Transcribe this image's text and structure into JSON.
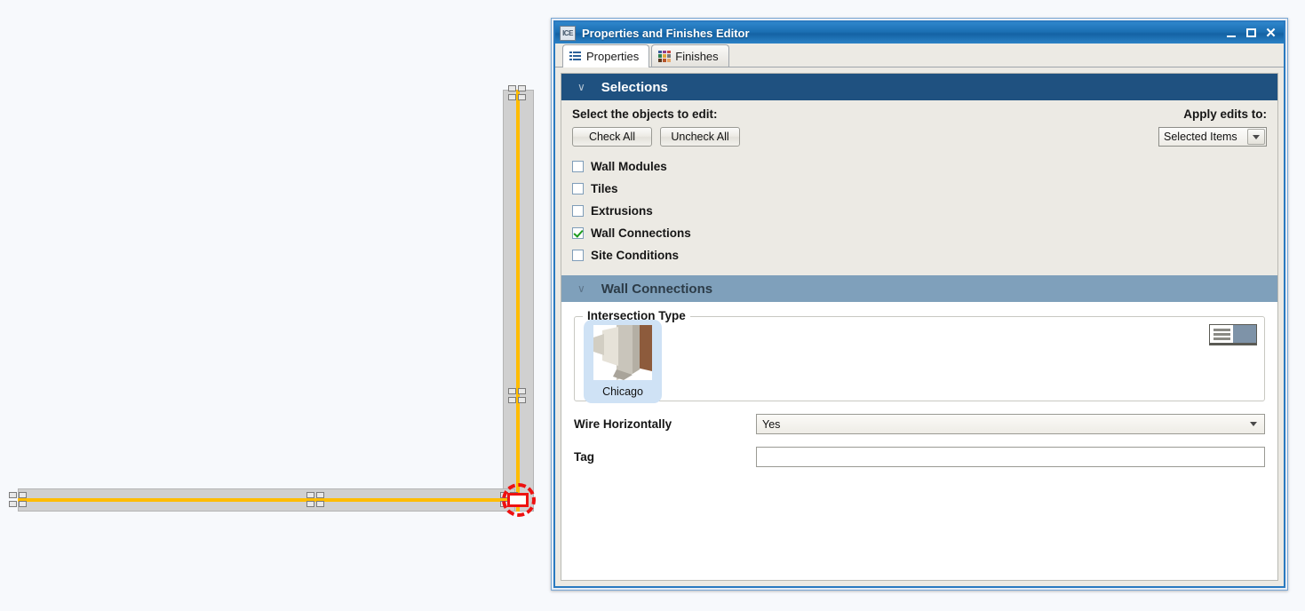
{
  "window": {
    "app_icon_label": "ICE",
    "title": "Properties and Finishes Editor",
    "minimize_label": "–",
    "maximize_label": "□",
    "close_label": "✕",
    "accent_color": "#1b6fb3"
  },
  "tabs": [
    {
      "label": "Properties",
      "icon": "list-properties-icon",
      "active": true
    },
    {
      "label": "Finishes",
      "icon": "color-swatches-icon",
      "active": false
    }
  ],
  "selections": {
    "header": "Selections",
    "collapse_glyph": "∨",
    "header_color": "#1f5180",
    "prompt": "Select the objects to edit:",
    "check_all_label": "Check All",
    "uncheck_all_label": "Uncheck All",
    "apply_label": "Apply edits to:",
    "apply_value": "Selected Items",
    "items": [
      {
        "label": "Wall Modules",
        "checked": false
      },
      {
        "label": "Tiles",
        "checked": false
      },
      {
        "label": "Extrusions",
        "checked": false
      },
      {
        "label": "Wall Connections",
        "checked": true
      },
      {
        "label": "Site Conditions",
        "checked": false
      }
    ]
  },
  "wall_connections": {
    "header": "Wall Connections",
    "collapse_glyph": "∨",
    "header_color": "#7fa0bb",
    "intersection_legend": "Intersection Type",
    "thumbnail": {
      "caption": "Chicago",
      "selected": true
    },
    "view_toggle": {
      "list_icon": "list-view-icon",
      "grid_icon": "thumbnail-view-icon",
      "active": "list"
    },
    "fields": [
      {
        "label": "Wire Horizontally",
        "type": "dropdown",
        "value": "Yes"
      },
      {
        "label": "Tag",
        "type": "text",
        "value": ""
      }
    ]
  },
  "canvas": {
    "background_color": "#f7f9fc",
    "wall_color": "#d0d0d0",
    "centerline_color": "#ffbc00",
    "selection_color": "#ee1111"
  }
}
